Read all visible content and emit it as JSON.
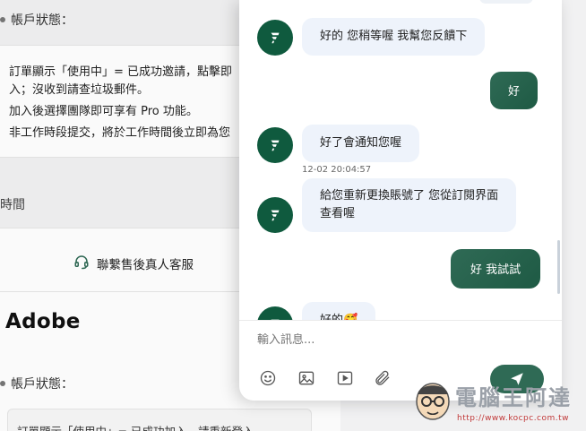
{
  "background": {
    "status_label_top": "帳戶狀態：",
    "notes": [
      "訂單顯示「使用中」= 已成功邀請，點擊即",
      "入；沒收到請查垃圾郵件。",
      "加入後選擇團隊即可享有 Pro 功能。",
      "非工作時段提交，將於工作時間後立即為您"
    ],
    "time_label": "時間",
    "support_label": "聯繫售後真人客服",
    "section_title": "Adobe",
    "status_label_bottom": "帳戶狀態：",
    "bottom_note": "訂單顯示「使用中」= 已成功加入，請重新登入"
  },
  "chat": {
    "messages": [
      {
        "from": "agent",
        "text": "好的 您稍等喔 我幫您反饋下"
      },
      {
        "from": "user",
        "text": "好"
      },
      {
        "from": "agent",
        "text": "好了會通知您喔",
        "timestamp": "12-02 20:04:57"
      },
      {
        "from": "agent",
        "text_line1": "給您重新更換賬號了 您從訂閱界面",
        "text_line2": "查看喔"
      },
      {
        "from": "user",
        "text": "好 我試試"
      },
      {
        "from": "agent",
        "text": "好的🥰"
      }
    ],
    "input_placeholder": "輸入訊息...",
    "toolbar": {
      "emoji": "emoji-icon",
      "image": "image-icon",
      "video": "video-icon",
      "attach": "paperclip-icon",
      "send": "send-icon"
    },
    "brand_color": "#1e5a44",
    "agent_bubble_color": "#eef3fb"
  },
  "watermark": {
    "title": "電腦王阿達",
    "url": "http://www.kocpc.com.tw"
  }
}
